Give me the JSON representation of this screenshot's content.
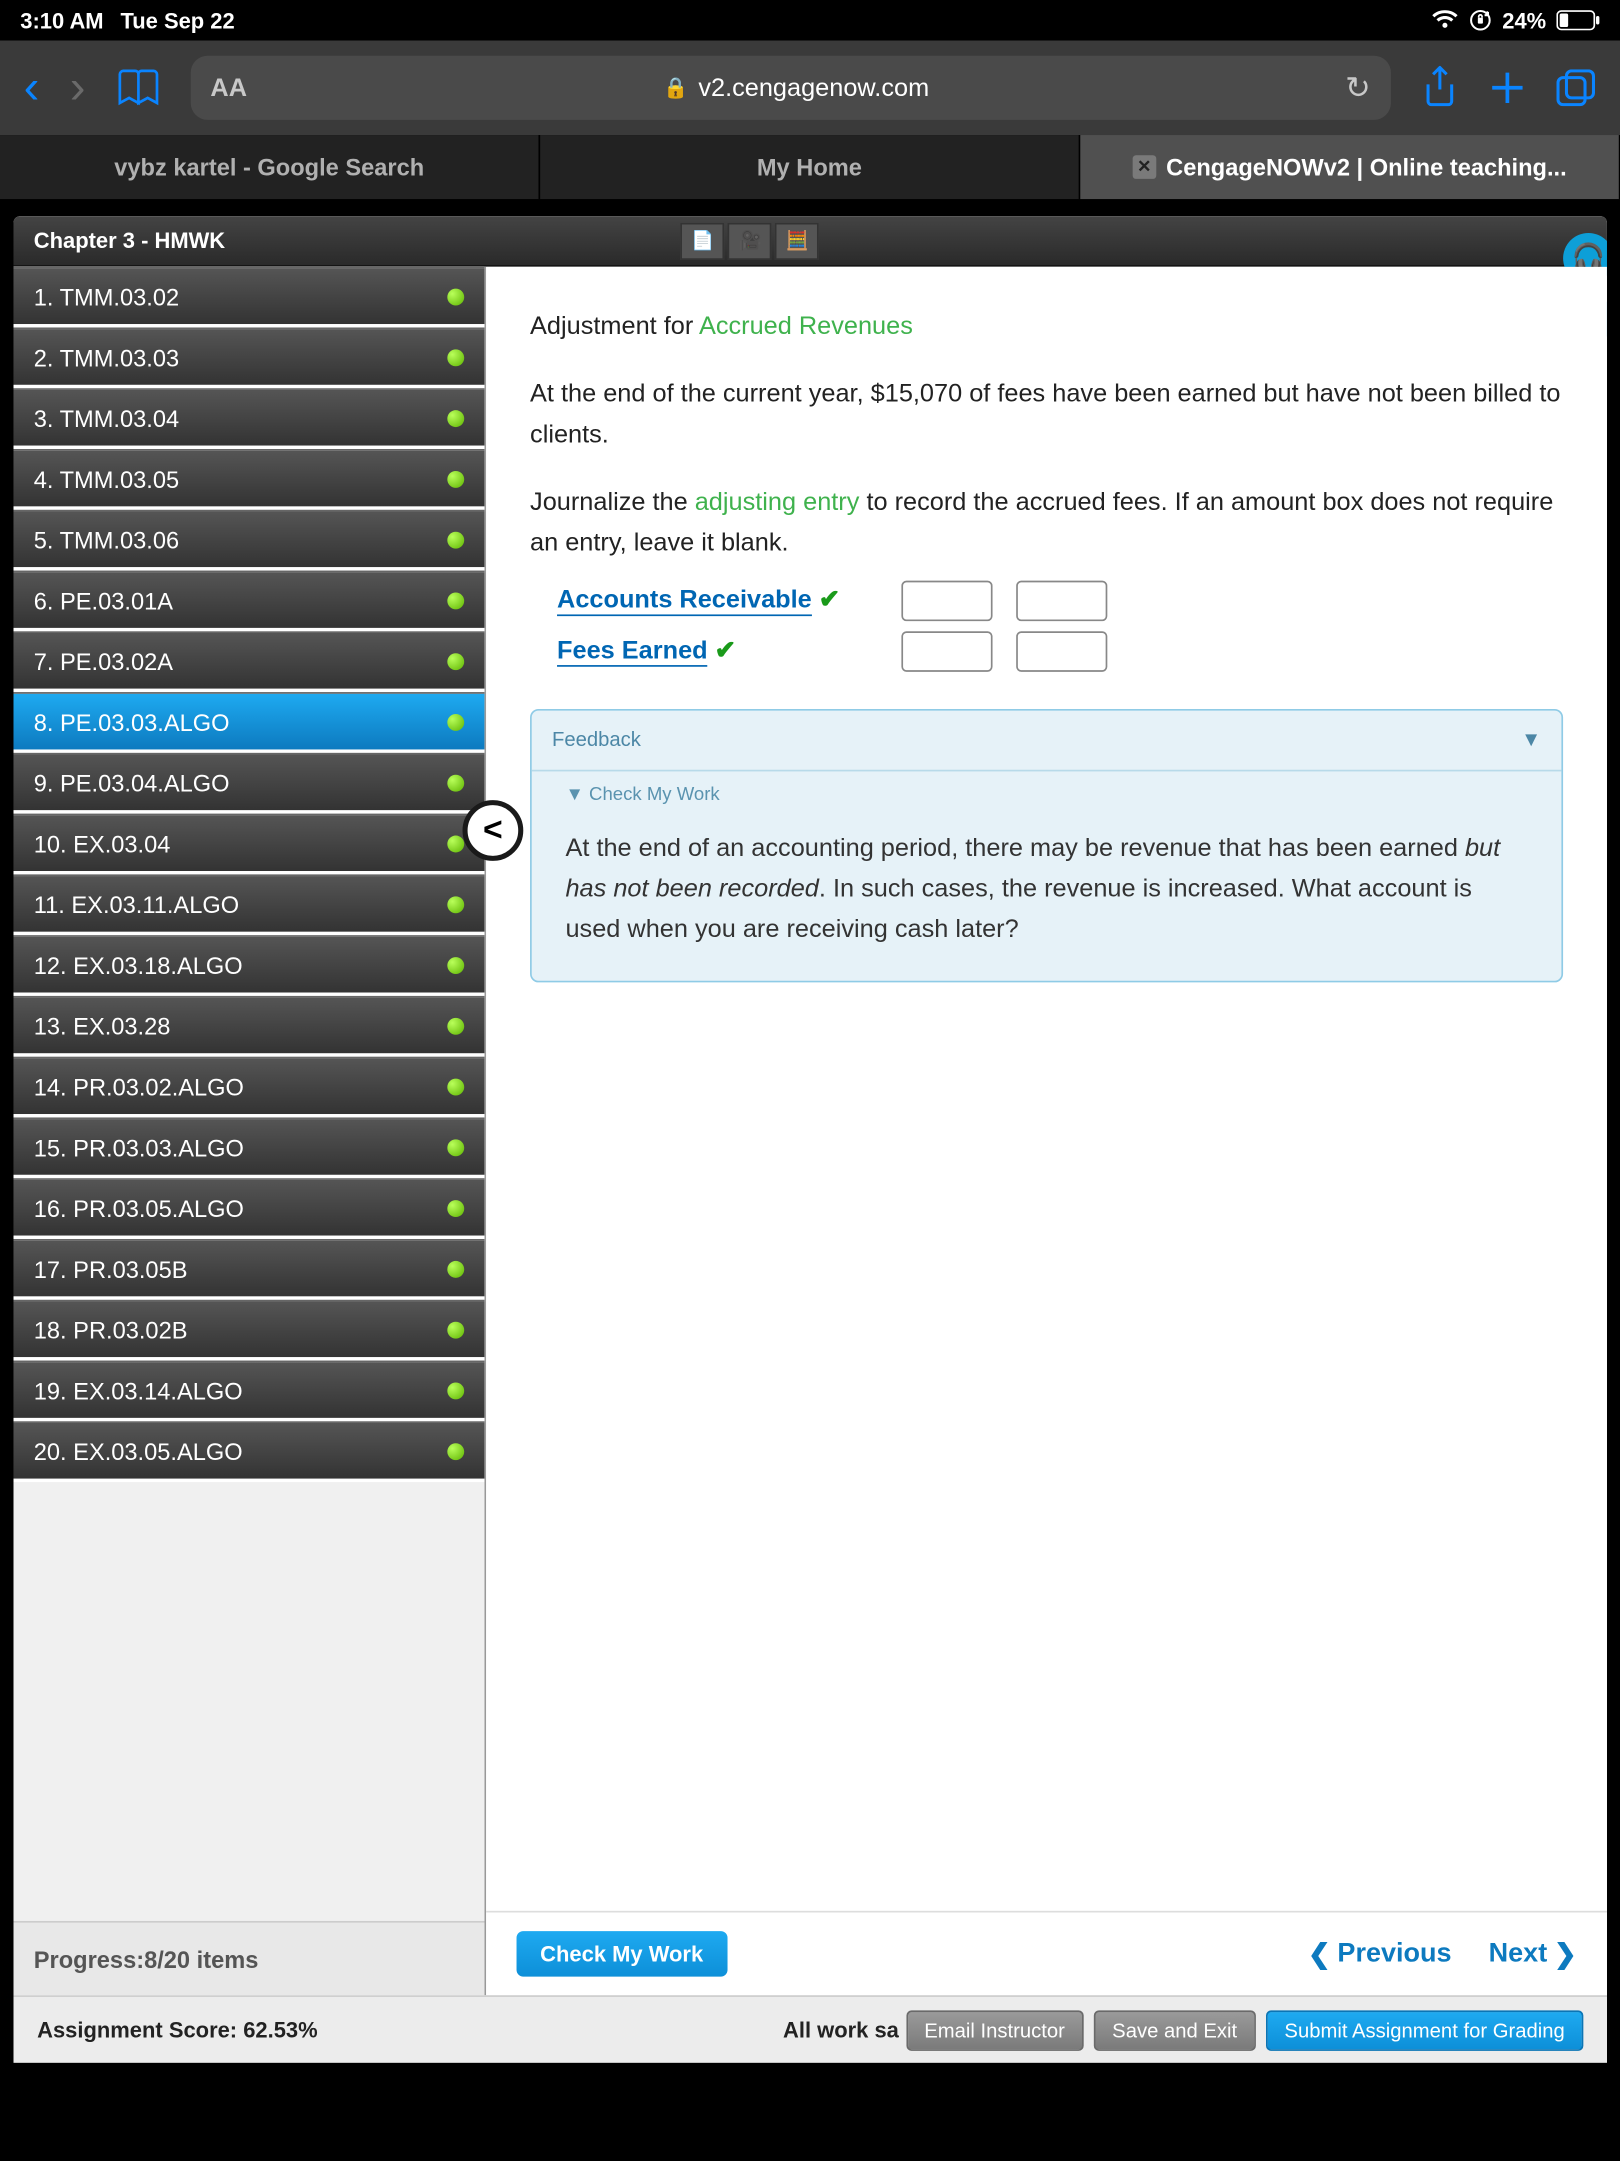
{
  "status": {
    "time": "3:10 AM",
    "date": "Tue Sep 22",
    "battery": "24%"
  },
  "browser": {
    "url": "v2.cengagenow.com"
  },
  "tabs": [
    {
      "label": "vybz kartel - Google Search"
    },
    {
      "label": "My Home"
    },
    {
      "label": "CengageNOWv2 | Online teaching..."
    }
  ],
  "header": {
    "title": "Chapter 3 - HMWK"
  },
  "sidebar": {
    "items": [
      {
        "label": "1. TMM.03.02"
      },
      {
        "label": "2. TMM.03.03"
      },
      {
        "label": "3. TMM.03.04"
      },
      {
        "label": "4. TMM.03.05"
      },
      {
        "label": "5. TMM.03.06"
      },
      {
        "label": "6. PE.03.01A"
      },
      {
        "label": "7. PE.03.02A"
      },
      {
        "label": "8. PE.03.03.ALGO",
        "selected": true
      },
      {
        "label": "9. PE.03.04.ALGO"
      },
      {
        "label": "10. EX.03.04"
      },
      {
        "label": "11. EX.03.11.ALGO"
      },
      {
        "label": "12. EX.03.18.ALGO"
      },
      {
        "label": "13. EX.03.28"
      },
      {
        "label": "14. PR.03.02.ALGO"
      },
      {
        "label": "15. PR.03.03.ALGO"
      },
      {
        "label": "16. PR.03.05.ALGO"
      },
      {
        "label": "17. PR.03.05B"
      },
      {
        "label": "18. PR.03.02B"
      },
      {
        "label": "19. EX.03.14.ALGO"
      },
      {
        "label": "20. EX.03.05.ALGO"
      }
    ],
    "progress": "Progress:8/20 items"
  },
  "content": {
    "title_prefix": "Adjustment for ",
    "title_link": "Accrued Revenues",
    "para1": "At the end of the current year, $15,070 of fees have been earned but have not been billed to clients.",
    "para2a": "Journalize the ",
    "para2_link": "adjusting entry",
    "para2b": " to record the accrued fees. If an amount box does not require an entry, leave it blank.",
    "row1": "Accounts Receivable",
    "row2": "Fees Earned",
    "feedback": {
      "head": "Feedback",
      "sub": "Check My Work",
      "body1": "At the end of an accounting period, there may be revenue that has been earned ",
      "body_em": "but has not been recorded",
      "body2": ". In such cases, the revenue is increased. What account is used when you are receiving cash later?"
    },
    "check_btn": "Check My Work",
    "prev": "Previous",
    "next": "Next"
  },
  "bottom": {
    "score": "Assignment Score: 62.53%",
    "saved": "All work sa",
    "email": "Email Instructor",
    "save": "Save and Exit",
    "submit": "Submit Assignment for Grading"
  }
}
